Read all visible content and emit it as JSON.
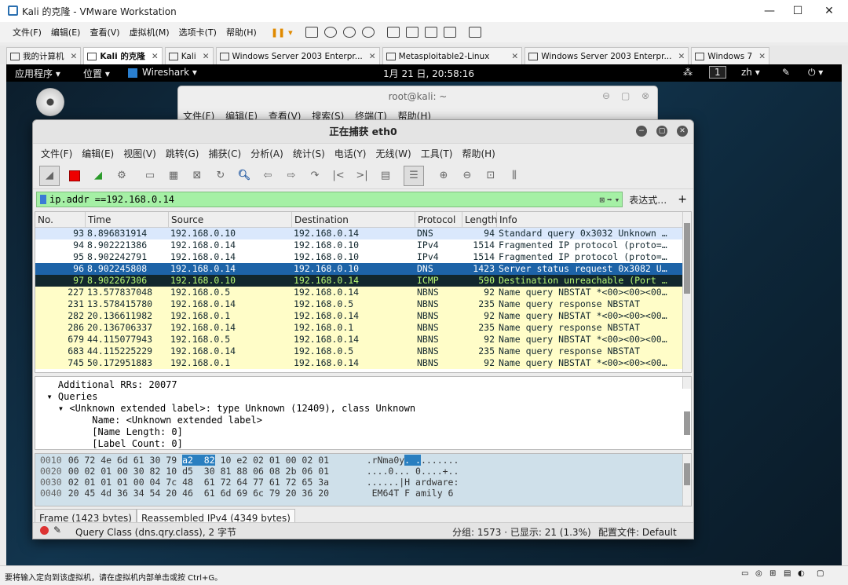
{
  "vmware": {
    "title": "Kali 的克隆 - VMware Workstation",
    "menu": [
      "文件(F)",
      "编辑(E)",
      "查看(V)",
      "虚拟机(M)",
      "选项卡(T)",
      "帮助(H)"
    ],
    "tabs": [
      {
        "label": "我的计算机",
        "active": false
      },
      {
        "label": "Kali 的克隆",
        "active": true
      },
      {
        "label": "Kali",
        "active": false
      },
      {
        "label": "Windows Server 2003 Enterpr...",
        "active": false
      },
      {
        "label": "Metasploitable2-Linux",
        "active": false
      },
      {
        "label": "Windows Server 2003 Enterpr...",
        "active": false
      },
      {
        "label": "Windows 7",
        "active": false
      }
    ],
    "status_hint": "要将输入定向到该虚拟机，请在虚拟机内部单击或按 Ctrl+G。"
  },
  "kali": {
    "apps_label": "应用程序 ▾",
    "places_label": "位置 ▾",
    "wireshark_label": "Wireshark ▾",
    "clock": "1月 21 日, 20:58:16",
    "workspace": "1",
    "lang": "zh ▾",
    "power": "⏻ ▾"
  },
  "terminal": {
    "title": "root@kali: ~",
    "menu": [
      "文件(F)",
      "编辑(E)",
      "查看(V)",
      "搜索(S)",
      "终端(T)",
      "帮助(H)"
    ]
  },
  "wireshark": {
    "title": "正在捕获 eth0",
    "menu": [
      "文件(F)",
      "编辑(E)",
      "视图(V)",
      "跳转(G)",
      "捕获(C)",
      "分析(A)",
      "统计(S)",
      "电话(Y)",
      "无线(W)",
      "工具(T)",
      "帮助(H)"
    ],
    "filter": "ip.addr ==192.168.0.14",
    "expression_label": "表达式…",
    "plus": "+",
    "columns": [
      "No.",
      "Time",
      "Source",
      "Destination",
      "Protocol",
      "Length",
      "Info"
    ],
    "packets": [
      {
        "no": "93",
        "time": "8.896831914",
        "src": "192.168.0.10",
        "dst": "192.168.0.14",
        "proto": "DNS",
        "len": "94",
        "info": "Standard query 0x3032 Unknown …",
        "style": "dns"
      },
      {
        "no": "94",
        "time": "8.902221386",
        "src": "192.168.0.14",
        "dst": "192.168.0.10",
        "proto": "IPv4",
        "len": "1514",
        "info": "Fragmented IP protocol (proto=…",
        "style": "ipv4"
      },
      {
        "no": "95",
        "time": "8.902242791",
        "src": "192.168.0.14",
        "dst": "192.168.0.10",
        "proto": "IPv4",
        "len": "1514",
        "info": "Fragmented IP protocol (proto=…",
        "style": "ipv4"
      },
      {
        "no": "96",
        "time": "8.902245808",
        "src": "192.168.0.14",
        "dst": "192.168.0.10",
        "proto": "DNS",
        "len": "1423",
        "info": "Server status request 0x3082 U…",
        "style": "selected"
      },
      {
        "no": "97",
        "time": "8.902267306",
        "src": "192.168.0.10",
        "dst": "192.168.0.14",
        "proto": "ICMP",
        "len": "590",
        "info": "Destination unreachable (Port …",
        "style": "icmp"
      },
      {
        "no": "227",
        "time": "13.577837048",
        "src": "192.168.0.5",
        "dst": "192.168.0.14",
        "proto": "NBNS",
        "len": "92",
        "info": "Name query NBSTAT *<00><00><00…",
        "style": "nbns"
      },
      {
        "no": "231",
        "time": "13.578415780",
        "src": "192.168.0.14",
        "dst": "192.168.0.5",
        "proto": "NBNS",
        "len": "235",
        "info": "Name query response NBSTAT",
        "style": "nbns"
      },
      {
        "no": "282",
        "time": "20.136611982",
        "src": "192.168.0.1",
        "dst": "192.168.0.14",
        "proto": "NBNS",
        "len": "92",
        "info": "Name query NBSTAT *<00><00><00…",
        "style": "nbns"
      },
      {
        "no": "286",
        "time": "20.136706337",
        "src": "192.168.0.14",
        "dst": "192.168.0.1",
        "proto": "NBNS",
        "len": "235",
        "info": "Name query response NBSTAT",
        "style": "nbns"
      },
      {
        "no": "679",
        "time": "44.115077943",
        "src": "192.168.0.5",
        "dst": "192.168.0.14",
        "proto": "NBNS",
        "len": "92",
        "info": "Name query NBSTAT *<00><00><00…",
        "style": "nbns"
      },
      {
        "no": "683",
        "time": "44.115225229",
        "src": "192.168.0.14",
        "dst": "192.168.0.5",
        "proto": "NBNS",
        "len": "235",
        "info": "Name query response NBSTAT",
        "style": "nbns"
      },
      {
        "no": "745",
        "time": "50.172951883",
        "src": "192.168.0.1",
        "dst": "192.168.0.14",
        "proto": "NBNS",
        "len": "92",
        "info": "Name query NBSTAT *<00><00><00…",
        "style": "nbns"
      }
    ],
    "details": [
      "    Additional RRs: 20077",
      "  ▾ Queries",
      "    ▾ <Unknown extended label>: type Unknown (12409), class Unknown",
      "          Name: <Unknown extended label>",
      "          [Name Length: 0]",
      "          [Label Count: 0]"
    ],
    "bytes": [
      {
        "off": "0010",
        "hex_a": "06 72 4e 6d 61 30 79 ",
        "hex_hl": "a2  82",
        "hex_b": " 10 e2 02 01 00 02 01",
        "ascii_a": ".rNma0y",
        "ascii_hl": ". .",
        "ascii_b": "......."
      },
      {
        "off": "0020",
        "hex_a": "00 02 01 00 30 82 10 d5  30 81 88 06 08 2b 06 01",
        "hex_hl": "",
        "hex_b": "",
        "ascii_a": "....0... 0....+..",
        "ascii_hl": "",
        "ascii_b": ""
      },
      {
        "off": "0030",
        "hex_a": "02 01 01 01 00 04 7c 48  61 72 64 77 61 72 65 3a",
        "hex_hl": "",
        "hex_b": "",
        "ascii_a": "......|H ardware:",
        "ascii_hl": "",
        "ascii_b": ""
      },
      {
        "off": "0040",
        "hex_a": "20 45 4d 36 34 54 20 46  61 6d 69 6c 79 20 36 20",
        "hex_hl": "",
        "hex_b": "",
        "ascii_a": " EM64T F amily 6",
        "ascii_hl": "",
        "ascii_b": ""
      }
    ],
    "byte_tabs": [
      "Frame (1423 bytes)",
      "Reassembled IPv4 (4349 bytes)"
    ],
    "status_field": "Query Class (dns.qry.class), 2 字节",
    "status_counts": "分组: 1573 · 已显示: 21 (1.3%)",
    "status_profile": "配置文件: Default",
    "colors": {
      "dns": "#dae8fc",
      "ipv4": "#ffffff",
      "selected": "#1d63a7",
      "icmp": "#12272e",
      "nbns": "#fffdc8",
      "filter_bg": "#a5f0a5"
    }
  }
}
